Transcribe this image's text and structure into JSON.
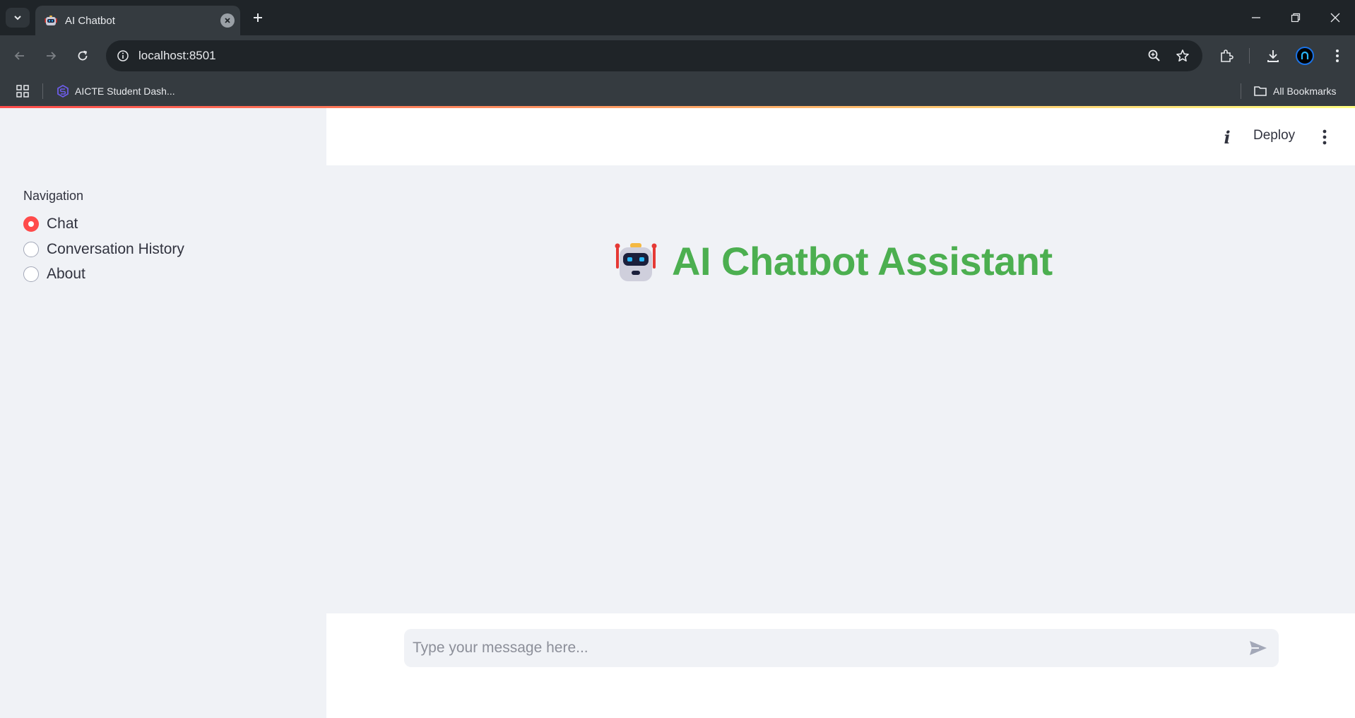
{
  "browser": {
    "tab_title": "AI Chatbot",
    "url": "localhost:8501",
    "bookmarks": [
      {
        "label": "AICTE Student Dash..."
      }
    ],
    "all_bookmarks_label": "All Bookmarks"
  },
  "header": {
    "deploy_label": "Deploy"
  },
  "sidebar": {
    "title": "Navigation",
    "options": [
      {
        "label": "Chat",
        "selected": true
      },
      {
        "label": "Conversation History",
        "selected": false
      },
      {
        "label": "About",
        "selected": false
      }
    ]
  },
  "main": {
    "title": "AI Chatbot Assistant",
    "title_icon": "robot-icon",
    "title_color": "#4caf50"
  },
  "chat_input": {
    "placeholder": "Type your message here...",
    "value": ""
  },
  "colors": {
    "accent": "#ff4b4b",
    "title": "#4caf50"
  }
}
